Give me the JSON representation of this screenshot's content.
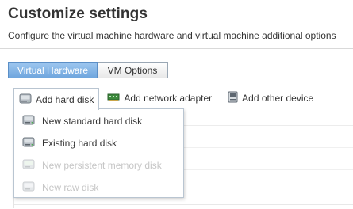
{
  "header": {
    "title": "Customize settings",
    "subtitle": "Configure the virtual machine hardware and virtual machine additional options"
  },
  "tabs": [
    {
      "label": "Virtual Hardware",
      "active": true
    },
    {
      "label": "VM Options",
      "active": false
    }
  ],
  "toolbar": {
    "add_hard_disk": {
      "label": "Add hard disk",
      "icon": "hard-disk-icon"
    },
    "add_network_adapter": {
      "label": "Add network adapter",
      "icon": "network-adapter-icon"
    },
    "add_other_device": {
      "label": "Add other device",
      "icon": "device-icon"
    }
  },
  "hard_disk_menu": {
    "items": [
      {
        "label": "New standard hard disk",
        "enabled": true,
        "icon": "hard-disk-icon"
      },
      {
        "label": "Existing hard disk",
        "enabled": true,
        "icon": "hard-disk-icon"
      },
      {
        "label": "New persistent memory disk",
        "enabled": false,
        "icon": "memory-disk-icon"
      },
      {
        "label": "New raw disk",
        "enabled": false,
        "icon": "raw-disk-icon"
      }
    ]
  },
  "colors": {
    "active_tab": "#7fb3e6",
    "text": "#333333",
    "disabled_text": "#c6c6c6",
    "border": "#b9c5d1"
  }
}
